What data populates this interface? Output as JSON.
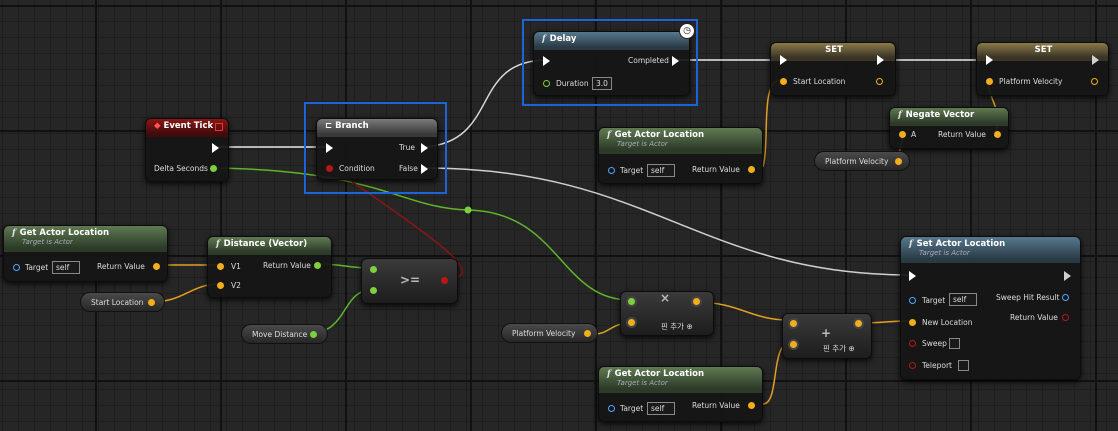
{
  "graph": {
    "event_tick": {
      "title": "Event Tick",
      "delta": "Delta Seconds"
    },
    "branch": {
      "title": "Branch",
      "condition": "Condition",
      "true_label": "True",
      "false_label": "False"
    },
    "delay": {
      "title": "Delay",
      "completed": "Completed",
      "duration_label": "Duration",
      "duration_value": "3.0"
    },
    "set1": {
      "title": "SET",
      "var": "Start Location"
    },
    "set2": {
      "title": "SET",
      "var": "Platform Velocity"
    },
    "negate": {
      "title": "Negate Vector",
      "a": "A",
      "ret": "Return Value"
    },
    "gal_left": {
      "title": "Get Actor Location",
      "sub": "Target is Actor",
      "target": "Target",
      "self": "self",
      "ret": "Return Value"
    },
    "gal_mid": {
      "title": "Get Actor Location",
      "sub": "Target is Actor",
      "target": "Target",
      "self": "self",
      "ret": "Return Value"
    },
    "gal_bottom": {
      "title": "Get Actor Location",
      "sub": "Target is Actor",
      "target": "Target",
      "self": "self",
      "ret": "Return Value"
    },
    "distance": {
      "title": "Distance (Vector)",
      "v1": "V1",
      "v2": "V2",
      "ret": "Return Value"
    },
    "compare": {
      "op": ">="
    },
    "multiply": {
      "op": "×",
      "add_pin": "핀 추가"
    },
    "add": {
      "op": "+",
      "add_pin": "핀 추가"
    },
    "set_loc": {
      "title": "Set Actor Location",
      "sub": "Target is Actor",
      "target": "Target",
      "self": "self",
      "new_loc": "New Location",
      "sweep": "Sweep",
      "teleport": "Teleport",
      "sweep_hit": "Sweep Hit Result",
      "ret": "Return Value"
    },
    "vars": {
      "start_location": "Start Location",
      "move_distance": "Move Distance",
      "platform_velocity_1": "Platform Velocity",
      "platform_velocity_2": "Platform Velocity"
    }
  },
  "colors": {
    "exec": "#ffffff",
    "vector": "#f3ae1b",
    "float": "#7ecf3b",
    "bool": "#b81717",
    "object": "#4da8ff",
    "selection": "#1e63d8"
  }
}
